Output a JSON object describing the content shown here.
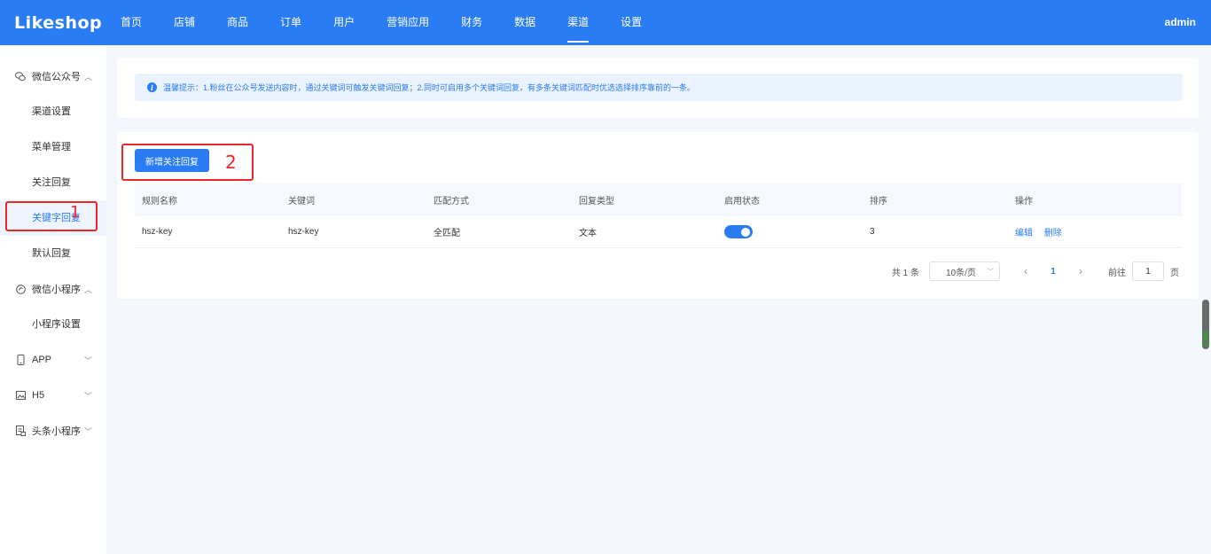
{
  "header": {
    "logo": "Likeshop",
    "nav": [
      {
        "label": "首页"
      },
      {
        "label": "店铺"
      },
      {
        "label": "商品"
      },
      {
        "label": "订单"
      },
      {
        "label": "用户"
      },
      {
        "label": "营销应用"
      },
      {
        "label": "财务"
      },
      {
        "label": "数据"
      },
      {
        "label": "渠道",
        "active": true
      },
      {
        "label": "设置"
      }
    ],
    "user": "admin",
    "colors": {
      "primary": "#2a7cf4"
    }
  },
  "sidebar": {
    "wechat_oa": {
      "label": "微信公众号",
      "icon": "wechat-icon"
    },
    "oa_items": [
      "渠道设置",
      "菜单管理",
      "关注回复",
      "关键字回复",
      "默认回复"
    ],
    "mini": {
      "label": "微信小程序",
      "icon": "mini-program-icon"
    },
    "mini_items": [
      "小程序设置"
    ],
    "app": {
      "label": "APP",
      "icon": "phone-icon"
    },
    "h5": {
      "label": "H5",
      "icon": "image-icon"
    },
    "toutiao": {
      "label": "头条小程序",
      "icon": "doc-icon"
    }
  },
  "alert": {
    "text": "温馨提示：1.粉丝在公众号发送内容时，通过关键词可触发关键词回复；2.同时可启用多个关键词回复，有多条关键词匹配时优选选择排序靠前的一条。"
  },
  "toolbar": {
    "add_label": "新增关注回复"
  },
  "table": {
    "columns": [
      "规则名称",
      "关键词",
      "匹配方式",
      "回复类型",
      "启用状态",
      "排序",
      "操作"
    ],
    "rows": [
      {
        "name": "hsz-key",
        "keyword": "hsz-key",
        "match": "全匹配",
        "type": "文本",
        "enabled": true,
        "sort": "3",
        "edit": "编辑",
        "delete": "删除"
      }
    ]
  },
  "pagination": {
    "total": "共 1 条",
    "page_size": "10条/页",
    "current": "1",
    "goto_label": "前往",
    "goto_value": "1",
    "page_suffix": "页"
  },
  "annotations": {
    "one": "1",
    "two": "2",
    "color": "#e8282b"
  }
}
